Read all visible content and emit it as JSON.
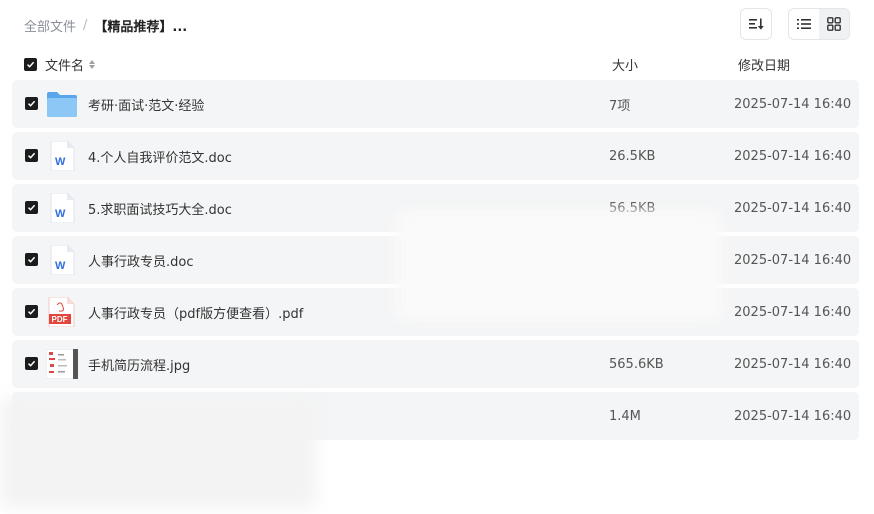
{
  "breadcrumb": {
    "root": "全部文件",
    "separator": "/",
    "current": "【精品推荐】..."
  },
  "columns": {
    "name": "文件名",
    "size": "大小",
    "date": "修改日期"
  },
  "files": [
    {
      "name": "考研·面试·范文·经验",
      "size": "7项",
      "date": "2025-07-14 16:40",
      "icon": "folder-icon"
    },
    {
      "name": "4.个人自我评价范文.doc",
      "size": "26.5KB",
      "date": "2025-07-14 16:40",
      "icon": "word-doc-icon"
    },
    {
      "name": "5.求职面试技巧大全.doc",
      "size": "56.5KB",
      "date": "2025-07-14 16:40",
      "icon": "word-doc-icon"
    },
    {
      "name": "人事行政专员.doc",
      "size": "",
      "date": "2025-07-14 16:40",
      "icon": "word-doc-icon"
    },
    {
      "name": "人事行政专员（pdf版方便查看）.pdf",
      "size": "",
      "date": "2025-07-14 16:40",
      "icon": "pdf-icon"
    },
    {
      "name": "手机简历流程.jpg",
      "size": "565.6KB",
      "date": "2025-07-14 16:40",
      "icon": "image-icon"
    },
    {
      "name": "",
      "size": "1.4M",
      "date": "2025-07-14 16:40",
      "icon": ""
    }
  ],
  "colors": {
    "row_bg": "#f4f5f6",
    "folder": "#6cb2f0",
    "word": "#2f6fdc",
    "pdf": "#e2463c",
    "checkbox": "#1c1c1c"
  }
}
